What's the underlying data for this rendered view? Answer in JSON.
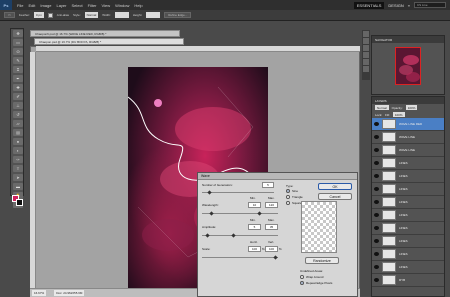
{
  "app": {
    "logo": "Ps"
  },
  "menu": [
    "File",
    "Edit",
    "Image",
    "Layer",
    "Select",
    "Filter",
    "View",
    "Window",
    "Help"
  ],
  "workspaces": {
    "essentials": "ESSENTIALS",
    "design": "DESIGN",
    "more": "»"
  },
  "search": {
    "value": "CS Live"
  },
  "options_bar": {
    "feather_label": "Feather:",
    "feather_value": "0 px",
    "antialias_label": "Anti-alias",
    "style_label": "Style:",
    "style_value": "Normal",
    "width_label": "Width:",
    "height_label": "Height:",
    "refine_edge": "Refine Edge..."
  },
  "documents": {
    "tab1": "Chaopon6.psd @ 16.7% (WAVE LINE RED, RGB/8) *",
    "tab2": "Chaopon.psd @ 16.7% (DU BOOYA, RGB/8) *"
  },
  "status": {
    "zoom": "16.67%",
    "doc": "Doc: 24.9M/255.6M"
  },
  "navigator": {
    "title": "NAVIGATOR"
  },
  "layers": {
    "title": "LAYERS",
    "blend_mode": "Normal",
    "opacity_label": "Opacity:",
    "opacity": "100%",
    "lock_label": "Lock:",
    "fill_label": "Fill:",
    "fill": "100%",
    "items": [
      {
        "name": "WAVE LINE RED",
        "selected": true
      },
      {
        "name": "WAVE LINE"
      },
      {
        "name": "WAVE LINE"
      },
      {
        "name": "LINES"
      },
      {
        "name": "LINES"
      },
      {
        "name": "LINES"
      },
      {
        "name": "LINES"
      },
      {
        "name": "LINES"
      },
      {
        "name": "LINES"
      },
      {
        "name": "LINES"
      },
      {
        "name": "LINES"
      },
      {
        "name": "LINES"
      },
      {
        "name": "RYB"
      }
    ]
  },
  "wave_dialog": {
    "title": "Wave",
    "generators_label": "Number of Generators:",
    "generators_value": "5",
    "min_label": "Min.",
    "max_label": "Max.",
    "wavelength_label": "Wavelength:",
    "wavelength_min": "10",
    "wavelength_max": "120",
    "amplitude_label": "Amplitude:",
    "amplitude_min": "5",
    "amplitude_max": "35",
    "horiz_label": "Horiz.",
    "vert_label": "Vert.",
    "scale_label": "Scale:",
    "scale_horiz": "100",
    "scale_vert": "100",
    "scale_unit": "%",
    "type_label": "Type:",
    "type_options": [
      "Sine",
      "Triangle",
      "Square"
    ],
    "ok": "OK",
    "cancel": "Cancel",
    "randomize": "Randomize",
    "undefined_label": "Undefined Areas:",
    "undefined_options": [
      "Wrap Around",
      "Repeat Edge Pixels"
    ]
  },
  "colors": {
    "foreground": "#d1245e",
    "background": "#111111",
    "layer_selected": "#4a7fc5",
    "accent": "#c8235a"
  }
}
